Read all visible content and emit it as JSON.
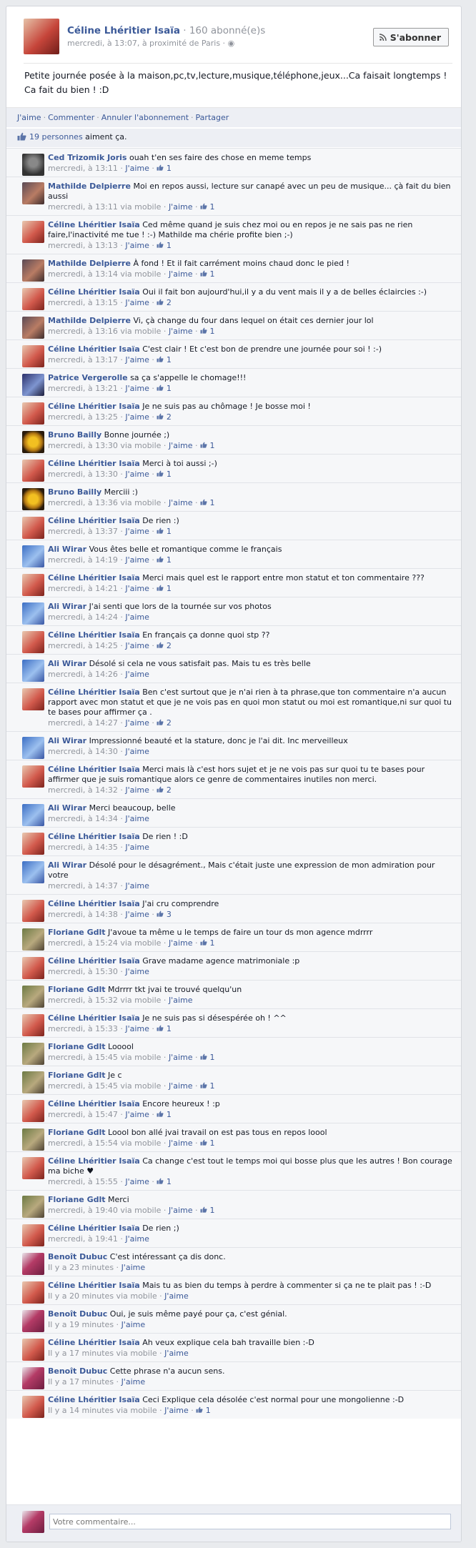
{
  "post": {
    "author": "Céline Lhéritier Isaïa",
    "subscribers": " · 160 abonné(e)s",
    "meta": "mercredi, à 13:07, à proximité de Paris · ",
    "subscribe_label": "S'abonner",
    "status_text": "Petite journée posée à la maison,pc,tv,lecture,musique,téléphone,jeux...Ca faisait longtemps ! Ca fait du bien ! :D"
  },
  "actions": [
    "J'aime",
    "Commenter",
    "Annuler l'abonnement",
    "Partager"
  ],
  "likes": {
    "link": "19 personnes",
    "rest": " aiment ça."
  },
  "comments": [
    {
      "author": "Ced Trizomik Joris",
      "text": "ouah t'en ses faire des chose en meme temps",
      "time": "mercredi, à 13:11",
      "like": "J'aime",
      "count": "1",
      "av": "ced"
    },
    {
      "author": "Mathilde Delpierre",
      "text": "Moi en repos aussi, lecture sur canapé avec un peu de musique... çà fait du bien aussi",
      "time": "mercredi, à 13:11 via mobile",
      "like": "J'aime",
      "count": "1",
      "av": "mathilde"
    },
    {
      "author": "Céline Lhéritier Isaïa",
      "text": "Ced même quand je suis chez moi ou en repos je ne sais pas ne rien faire,l'inactivité me tue ! :-) Mathilde ma chérie profite bien ;-)",
      "time": "mercredi, à 13:13",
      "like": "J'aime",
      "count": "1",
      "av": "celine"
    },
    {
      "author": "Mathilde Delpierre",
      "text": "À fond ! Et il fait carrément moins chaud donc le pied !",
      "time": "mercredi, à 13:14 via mobile",
      "like": "J'aime",
      "count": "1",
      "av": "mathilde"
    },
    {
      "author": "Céline Lhéritier Isaïa",
      "text": "Oui il fait bon aujourd'hui,il y a du vent mais il y a de belles éclaircies :-)",
      "time": "mercredi, à 13:15",
      "like": "J'aime",
      "count": "2",
      "av": "celine"
    },
    {
      "author": "Mathilde Delpierre",
      "text": "Vi, çà change du four dans lequel on était ces dernier jour lol",
      "time": "mercredi, à 13:16 via mobile",
      "like": "J'aime",
      "count": "1",
      "av": "mathilde"
    },
    {
      "author": "Céline Lhéritier Isaïa",
      "text": "C'est clair ! Et c'est bon de prendre une journée pour soi ! :-)",
      "time": "mercredi, à 13:17",
      "like": "J'aime",
      "count": "1",
      "av": "celine"
    },
    {
      "author": "Patrice Vergerolle",
      "text": "sa ça s'appelle le chomage!!!",
      "time": "mercredi, à 13:21",
      "like": "J'aime",
      "count": "1",
      "av": "patrice"
    },
    {
      "author": "Céline Lhéritier Isaïa",
      "text": "Je ne suis pas au chômage ! Je bosse moi !",
      "time": "mercredi, à 13:25",
      "like": "J'aime",
      "count": "2",
      "av": "celine"
    },
    {
      "author": "Bruno Bailly",
      "text": "Bonne journée ;)",
      "time": "mercredi, à 13:30 via mobile",
      "like": "J'aime",
      "count": "1",
      "av": "bruno"
    },
    {
      "author": "Céline Lhéritier Isaïa",
      "text": "Merci à toi aussi ;-)",
      "time": "mercredi, à 13:30",
      "like": "J'aime",
      "count": "1",
      "av": "celine"
    },
    {
      "author": "Bruno Bailly",
      "text": "Merciii :)",
      "time": "mercredi, à 13:36 via mobile",
      "like": "J'aime",
      "count": "1",
      "av": "bruno"
    },
    {
      "author": "Céline Lhéritier Isaïa",
      "text": "De rien :)",
      "time": "mercredi, à 13:37",
      "like": "J'aime",
      "count": "1",
      "av": "celine"
    },
    {
      "author": "Ali Wirar",
      "text": "Vous êtes belle et romantique comme le français",
      "time": "mercredi, à 14:19",
      "like": "J'aime",
      "count": "1",
      "av": "ali"
    },
    {
      "author": "Céline Lhéritier Isaïa",
      "text": "Merci mais quel est le rapport entre mon statut et ton commentaire ???",
      "time": "mercredi, à 14:21",
      "like": "J'aime",
      "count": "1",
      "av": "celine"
    },
    {
      "author": "Ali Wirar",
      "text": "J'ai senti que lors de la tournée sur vos photos",
      "time": "mercredi, à 14:24",
      "like": "J'aime",
      "count": "",
      "av": "ali"
    },
    {
      "author": "Céline Lhéritier Isaïa",
      "text": "En français ça donne quoi stp ??",
      "time": "mercredi, à 14:25",
      "like": "J'aime",
      "count": "2",
      "av": "celine"
    },
    {
      "author": "Ali Wirar",
      "text": "Désolé si cela ne vous satisfait pas. Mais tu es très belle",
      "time": "mercredi, à 14:26",
      "like": "J'aime",
      "count": "",
      "av": "ali"
    },
    {
      "author": "Céline Lhéritier Isaïa",
      "text": "Ben c'est surtout que je n'ai rien à ta phrase,que ton commentaire n'a aucun rapport avec mon statut et que je ne vois pas en quoi mon statut ou moi est romantique,ni sur quoi tu te bases pour affirmer ça .",
      "time": "mercredi, à 14:27",
      "like": "J'aime",
      "count": "2",
      "av": "celine"
    },
    {
      "author": "Ali Wirar",
      "text": "Impressionné beauté et la stature, donc je l'ai dit. Inc merveilleux",
      "time": "mercredi, à 14:30",
      "like": "J'aime",
      "count": "",
      "av": "ali"
    },
    {
      "author": "Céline Lhéritier Isaïa",
      "text": "Merci mais là c'est hors sujet et je ne vois pas sur quoi tu te bases pour affirmer que je suis romantique alors ce genre de commentaires inutiles non merci.",
      "time": "mercredi, à 14:32",
      "like": "J'aime",
      "count": "2",
      "av": "celine"
    },
    {
      "author": "Ali Wirar",
      "text": "Merci beaucoup, belle",
      "time": "mercredi, à 14:34",
      "like": "J'aime",
      "count": "",
      "av": "ali"
    },
    {
      "author": "Céline Lhéritier Isaïa",
      "text": "De rien ! :D",
      "time": "mercredi, à 14:35",
      "like": "J'aime",
      "count": "",
      "av": "celine"
    },
    {
      "author": "Ali Wirar",
      "text": "Désolé pour le désagrément., Mais c'était juste une expression de mon admiration pour votre",
      "time": "mercredi, à 14:37",
      "like": "J'aime",
      "count": "",
      "av": "ali"
    },
    {
      "author": "Céline Lhéritier Isaïa",
      "text": "J'ai cru comprendre",
      "time": "mercredi, à 14:38",
      "like": "J'aime",
      "count": "3",
      "av": "celine"
    },
    {
      "author": "Floriane Gdlt",
      "text": "J'avoue ta même u le temps de faire un tour ds mon agence mdrrrr",
      "time": "mercredi, à 15:24 via mobile",
      "like": "J'aime",
      "count": "1",
      "av": "floriane"
    },
    {
      "author": "Céline Lhéritier Isaïa",
      "text": "Grave madame agence matrimoniale :p",
      "time": "mercredi, à 15:30",
      "like": "J'aime",
      "count": "",
      "av": "celine"
    },
    {
      "author": "Floriane Gdlt",
      "text": "Mdrrrr tkt jvai te trouvé quelqu'un",
      "time": "mercredi, à 15:32 via mobile",
      "like": "J'aime",
      "count": "",
      "av": "floriane"
    },
    {
      "author": "Céline Lhéritier Isaïa",
      "text": "Je ne suis pas si désespérée oh ! ^^",
      "time": "mercredi, à 15:33",
      "like": "J'aime",
      "count": "1",
      "av": "celine"
    },
    {
      "author": "Floriane Gdlt",
      "text": "Looool",
      "time": "mercredi, à 15:45 via mobile",
      "like": "J'aime",
      "count": "1",
      "av": "floriane"
    },
    {
      "author": "Floriane Gdlt",
      "text": "Je c",
      "time": "mercredi, à 15:45 via mobile",
      "like": "J'aime",
      "count": "1",
      "av": "floriane"
    },
    {
      "author": "Céline Lhéritier Isaïa",
      "text": "Encore heureux ! :p",
      "time": "mercredi, à 15:47",
      "like": "J'aime",
      "count": "1",
      "av": "celine"
    },
    {
      "author": "Floriane Gdlt",
      "text": "Loool bon allé jvai travail on est pas tous en repos loool",
      "time": "mercredi, à 15:54 via mobile",
      "like": "J'aime",
      "count": "1",
      "av": "floriane"
    },
    {
      "author": "Céline Lhéritier Isaïa",
      "text": "Ca change c'est tout le temps moi qui bosse plus que les autres ! Bon courage ma biche ♥",
      "time": "mercredi, à 15:55",
      "like": "J'aime",
      "count": "1",
      "av": "celine"
    },
    {
      "author": "Floriane Gdlt",
      "text": "Merci",
      "time": "mercredi, à 19:40 via mobile",
      "like": "J'aime",
      "count": "1",
      "av": "floriane"
    },
    {
      "author": "Céline Lhéritier Isaïa",
      "text": "De rien ;)",
      "time": "mercredi, à 19:41",
      "like": "J'aime",
      "count": "",
      "av": "celine"
    },
    {
      "author": "Benoît Dubuc",
      "text": "C'est intéressant ça dis donc.",
      "time": "Il y a 23 minutes",
      "like": "J'aime",
      "count": "",
      "av": "benoit"
    },
    {
      "author": "Céline Lhéritier Isaïa",
      "text": "Mais tu as bien du temps à perdre à commenter si ça ne te plait pas ! :-D",
      "time": "Il y a 20 minutes via mobile",
      "like": "J'aime",
      "count": "",
      "av": "celine"
    },
    {
      "author": "Benoît Dubuc",
      "text": "Oui, je suis même payé pour ça, c'est génial.",
      "time": "Il y a 19 minutes",
      "like": "J'aime",
      "count": "",
      "av": "benoit"
    },
    {
      "author": "Céline Lhéritier Isaïa",
      "text": "Ah veux explique cela bah travaille bien :-D",
      "time": "Il y a 17 minutes via mobile",
      "like": "J'aime",
      "count": "",
      "av": "celine"
    },
    {
      "author": "Benoît Dubuc",
      "text": "Cette phrase n'a aucun sens.",
      "time": "Il y a 17 minutes",
      "like": "J'aime",
      "count": "",
      "av": "benoit"
    },
    {
      "author": "Céline Lhéritier Isaïa",
      "text": "Ceci Explique cela désolée c'est normal pour une mongolienne :-D",
      "time": "Il y a 14 minutes via mobile",
      "like": "J'aime",
      "count": "1",
      "av": "celine"
    }
  ],
  "reply": {
    "placeholder": "Votre commentaire..."
  }
}
